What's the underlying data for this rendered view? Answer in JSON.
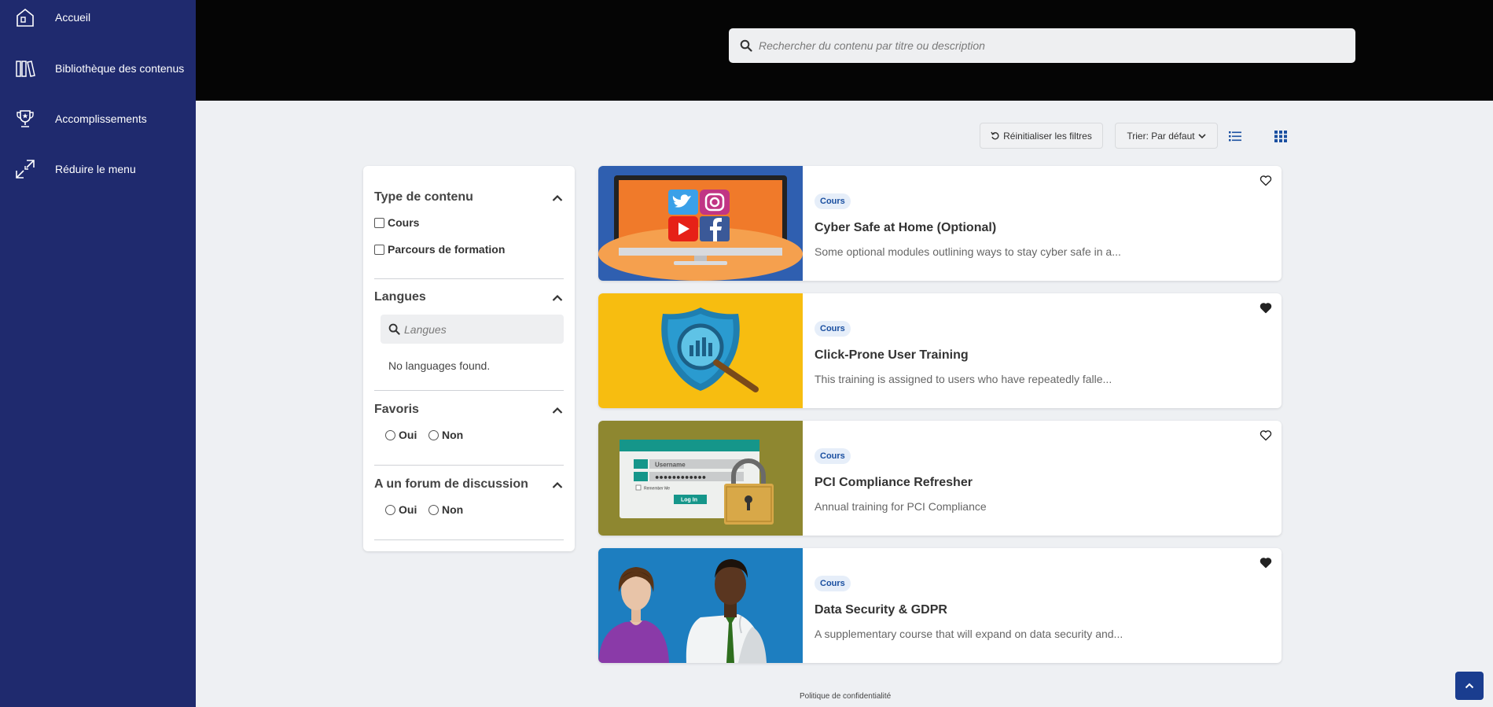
{
  "sidebar": {
    "items": [
      {
        "label": "Accueil",
        "icon": "home-icon"
      },
      {
        "label": "Bibliothèque des contenus",
        "icon": "library-icon"
      },
      {
        "label": "Accomplissements",
        "icon": "trophy-icon"
      },
      {
        "label": "Réduire le menu",
        "icon": "collapse-menu-icon"
      }
    ]
  },
  "search": {
    "placeholder": "Rechercher du contenu par titre ou description"
  },
  "toolbar": {
    "reset_label": "Réinitialiser les filtres",
    "sort_label": "Trier: Par défaut"
  },
  "filters": {
    "content_type": {
      "title": "Type de contenu",
      "options": [
        "Cours",
        "Parcours de formation"
      ]
    },
    "languages": {
      "title": "Langues",
      "placeholder": "Langues",
      "empty": "No languages found."
    },
    "favorites": {
      "title": "Favoris",
      "yes": "Oui",
      "no": "Non"
    },
    "forum": {
      "title": "A un forum de discussion",
      "yes": "Oui",
      "no": "Non"
    }
  },
  "cards": [
    {
      "badge": "Cours",
      "title": "Cyber Safe at Home (Optional)",
      "desc": "Some optional modules outlining ways to stay cyber safe in a...",
      "favorited": false
    },
    {
      "badge": "Cours",
      "title": "Click-Prone User Training",
      "desc": "This training is assigned to users who have repeatedly falle...",
      "favorited": true
    },
    {
      "badge": "Cours",
      "title": "PCI Compliance Refresher",
      "desc": "Annual training for PCI Compliance",
      "favorited": false
    },
    {
      "badge": "Cours",
      "title": "Data Security & GDPR",
      "desc": "A supplementary course that will expand on data security and...",
      "favorited": true
    }
  ],
  "thumb_text": {
    "username": "Username",
    "remember": "Remember Me",
    "login": "Log In"
  },
  "footer": {
    "privacy": "Politique de confidentialité"
  },
  "colors": {
    "sidebar": "#1f2a6e",
    "topbar": "#050505",
    "accent": "#1a4fa0",
    "background": "#eef0f3"
  }
}
